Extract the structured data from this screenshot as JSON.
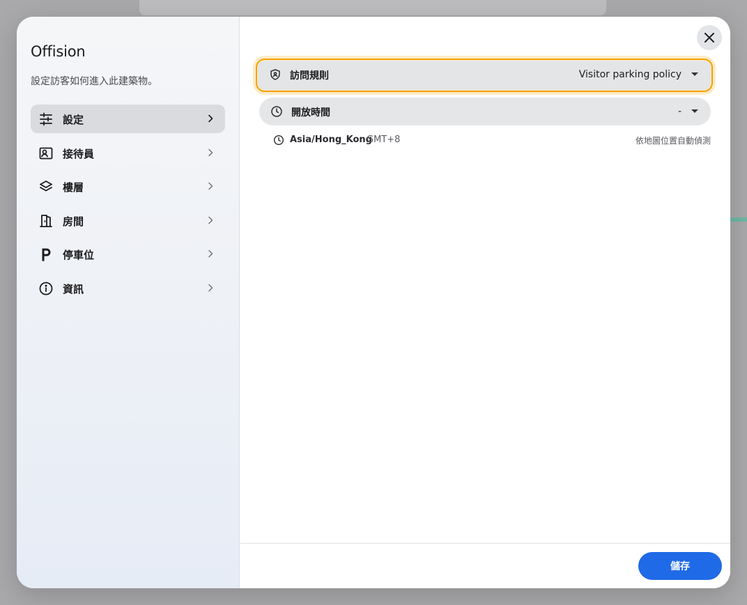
{
  "app": {
    "brand": "Offision",
    "subtitle": "設定訪客如何進入此建築物。"
  },
  "sidebar": {
    "items": [
      {
        "label": "設定",
        "icon": "sliders-icon",
        "active": true
      },
      {
        "label": "接待員",
        "icon": "id-card-icon"
      },
      {
        "label": "樓層",
        "icon": "layers-icon"
      },
      {
        "label": "房間",
        "icon": "door-icon"
      },
      {
        "label": "停車位",
        "icon": "parking-icon"
      },
      {
        "label": "資訊",
        "icon": "info-icon"
      }
    ]
  },
  "settings": {
    "visit_rule": {
      "label": "訪問規則",
      "value": "Visitor parking policy",
      "icon": "shield-icon"
    },
    "open_hours": {
      "label": "開放時間",
      "value": "-",
      "icon": "clock-icon"
    },
    "timezone": {
      "name": "Asia/Hong_Kong",
      "offset": "GMT+8",
      "note": "依地圖位置自動偵測",
      "icon": "clock-icon"
    }
  },
  "footer": {
    "save_label": "儲存"
  },
  "colors": {
    "accent": "#1f6ae6",
    "focus": "#f4a200"
  }
}
